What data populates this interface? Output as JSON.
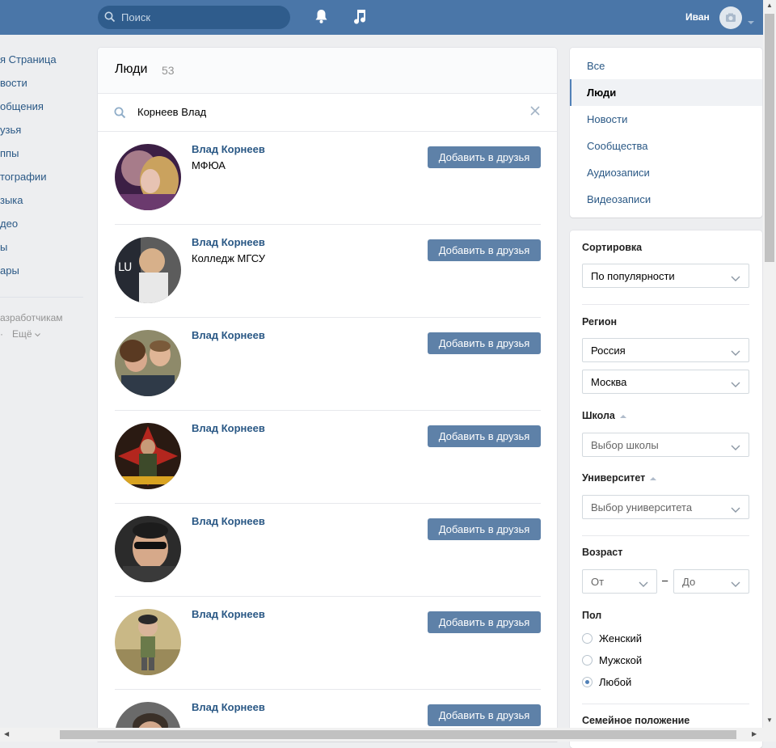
{
  "topbar": {
    "search_placeholder": "Поиск",
    "user_name": "Иван",
    "accent_color": "#4a76a8"
  },
  "left_nav": {
    "items": [
      {
        "label": "я Страница"
      },
      {
        "label": "вости"
      },
      {
        "label": "общения"
      },
      {
        "label": "узья"
      },
      {
        "label": "ппы"
      },
      {
        "label": "тографии"
      },
      {
        "label": "зыка"
      },
      {
        "label": "део"
      },
      {
        "label": "ы"
      },
      {
        "label": "ары"
      }
    ],
    "developers_label": "азработчикам",
    "more_label": "Ещё"
  },
  "main": {
    "title": "Люди",
    "count": "53",
    "query": "Корнеев Влад",
    "add_friend_label": "Добавить в друзья",
    "people": [
      {
        "name": "Влад Корнеев",
        "sub": "МФЮА",
        "avatar_color": "#6b3a6e"
      },
      {
        "name": "Влад Корнеев",
        "sub": "Колледж МГСУ",
        "avatar_color": "#4e4e4e"
      },
      {
        "name": "Влад Корнеев",
        "sub": "",
        "avatar_color": "#7c6a52"
      },
      {
        "name": "Влад Корнеев",
        "sub": "",
        "avatar_color": "#8b2a1e"
      },
      {
        "name": "Влад Корнеев",
        "sub": "",
        "avatar_color": "#3b3b3b"
      },
      {
        "name": "Влад Корнеев",
        "sub": "",
        "avatar_color": "#b9a77a"
      },
      {
        "name": "Влад Корнеев",
        "sub": "",
        "avatar_color": "#5d5d5d"
      }
    ]
  },
  "right_tabs": {
    "items": [
      {
        "label": "Все",
        "active": false
      },
      {
        "label": "Люди",
        "active": true
      },
      {
        "label": "Новости",
        "active": false
      },
      {
        "label": "Сообщества",
        "active": false
      },
      {
        "label": "Аудиозаписи",
        "active": false
      },
      {
        "label": "Видеозаписи",
        "active": false
      }
    ]
  },
  "filters": {
    "sort_label": "Сортировка",
    "sort_value": "По популярности",
    "region_label": "Регион",
    "country_value": "Россия",
    "city_value": "Москва",
    "school_label": "Школа",
    "school_placeholder": "Выбор школы",
    "university_label": "Университет",
    "university_placeholder": "Выбор университета",
    "age_label": "Возраст",
    "age_from": "От",
    "age_dash": "–",
    "age_to": "До",
    "sex_label": "Пол",
    "sex_options": [
      {
        "label": "Женский",
        "checked": false
      },
      {
        "label": "Мужской",
        "checked": false
      },
      {
        "label": "Любой",
        "checked": true
      }
    ],
    "marital_label": "Семейное положение"
  }
}
